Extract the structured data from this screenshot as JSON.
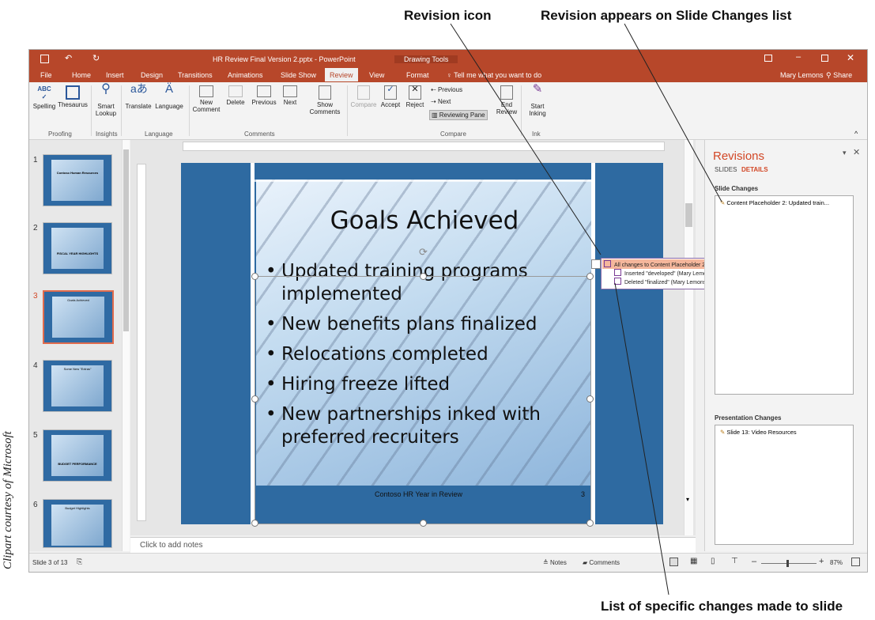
{
  "callouts": {
    "revision_icon": "Revision icon",
    "slide_changes": "Revision appears on Slide Changes list",
    "specific_changes": "List of specific changes made to slide"
  },
  "credit": "Clipart courtesy of Microsoft",
  "titlebar": {
    "title": "HR Review Final Version 2.pptx - PowerPoint",
    "context": "Drawing Tools",
    "user": "Mary Lemons",
    "share": "Share"
  },
  "tabs": [
    "File",
    "Home",
    "Insert",
    "Design",
    "Transitions",
    "Animations",
    "Slide Show",
    "Review",
    "View",
    "Format"
  ],
  "tell_me": "Tell me what you want to do",
  "ribbon": {
    "spelling": "Spelling",
    "thesaurus": "Thesaurus",
    "smart_lookup": "Smart Lookup",
    "translate": "Translate",
    "language": "Language",
    "new_comment": "New Comment",
    "delete": "Delete",
    "previous": "Previous",
    "next": "Next",
    "show_comments": "Show Comments",
    "compare": "Compare",
    "accept": "Accept",
    "reject": "Reject",
    "prev_small": "Previous",
    "next_small": "Next",
    "reviewing_pane": "Reviewing Pane",
    "end_review": "End Review",
    "start_inking": "Start Inking",
    "groups": {
      "proofing": "Proofing",
      "insights": "Insights",
      "language": "Language",
      "comments": "Comments",
      "compare": "Compare",
      "ink": "Ink"
    }
  },
  "thumbnails": [
    {
      "num": "1",
      "text": "Contoso Human Resources"
    },
    {
      "num": "2",
      "text": "FISCAL YEAR HIGHLIGHTS"
    },
    {
      "num": "3",
      "text": "Goals Achieved"
    },
    {
      "num": "4",
      "text": "Some New \"Extras\""
    },
    {
      "num": "5",
      "text": "BUDGET PERFORMANCE"
    },
    {
      "num": "6",
      "text": "Budget Highlights"
    }
  ],
  "slide": {
    "title": "Goals Achieved",
    "bullets": [
      "Updated training programs implemented",
      "New benefits plans finalized",
      "Relocations completed",
      "Hiring freeze lifted",
      "New partnerships inked with preferred recruiters"
    ],
    "footer": "Contoso HR Year in Review",
    "page": "3"
  },
  "popup": {
    "header": "All changes to Content Placeholder 2",
    "items": [
      "Inserted \"developed\" (Mary Lemons)",
      "Deleted \"finalized\" (Mary Lemons)"
    ]
  },
  "revisions": {
    "title": "Revisions",
    "tab_slides": "SLIDES",
    "tab_details": "DETAILS",
    "slide_changes_label": "Slide Changes",
    "slide_change_item": "Content Placeholder 2: Updated train...",
    "presentation_changes_label": "Presentation Changes",
    "presentation_change_item": "Slide 13: Video Resources"
  },
  "notes_placeholder": "Click to add notes",
  "status": {
    "slide_of": "Slide 3 of 13",
    "notes": "Notes",
    "comments": "Comments",
    "zoom": "87%"
  },
  "colors": {
    "accent": "#b7472a",
    "slide_blue": "#2e6aa1",
    "revision_purple": "#7a3b95"
  }
}
